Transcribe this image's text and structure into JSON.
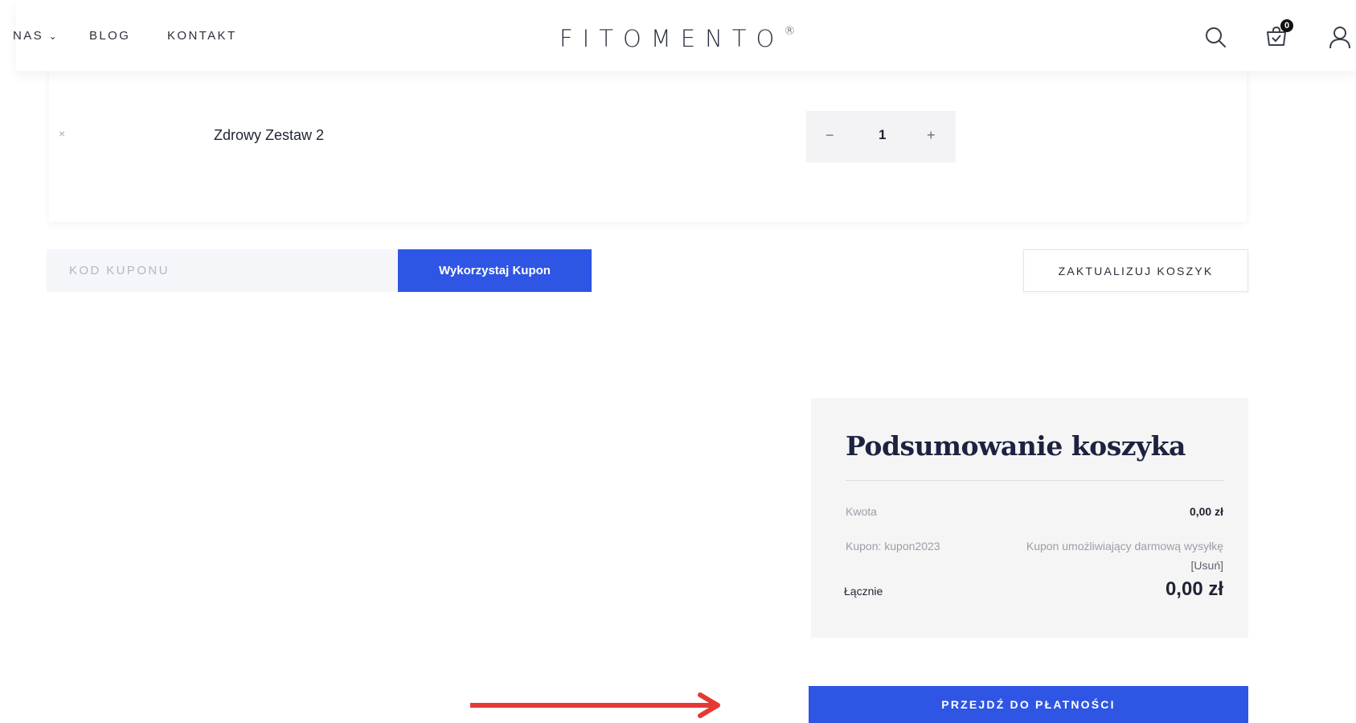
{
  "header": {
    "nav": [
      "NAS",
      "BLOG",
      "KONTAKT"
    ],
    "nav_dropdown_marker": "⌄",
    "logo": "FITOMENTO",
    "logo_mark": "®",
    "cart_count": "0",
    "icons": [
      "search-icon",
      "cart-icon",
      "user-icon"
    ]
  },
  "cart": {
    "remove_symbol": "×",
    "product_name": "Zdrowy Zestaw 2",
    "qty_minus": "−",
    "qty_value": "1",
    "qty_plus": "+"
  },
  "coupon": {
    "placeholder": "KOD KUPONU",
    "apply_label": "Wykorzystaj Kupon",
    "update_label": "ZAKTUALIZUJ KOSZYK"
  },
  "summary": {
    "title": "Podsumowanie koszyka",
    "subtotal_label": "Kwota",
    "subtotal_value": "0,00 zł",
    "coupon_label": "Kupon: kupon2023",
    "coupon_value": "Kupon umożliwiający darmową wysyłkę",
    "coupon_remove": "[Usuń]",
    "total_label": "Łącznie",
    "total_value": "0,00 zł"
  },
  "checkout": {
    "label": "PRZEJDŹ DO PŁATNOŚCI"
  },
  "colors": {
    "primary": "#2f55e4",
    "arrow": "#e53935"
  }
}
